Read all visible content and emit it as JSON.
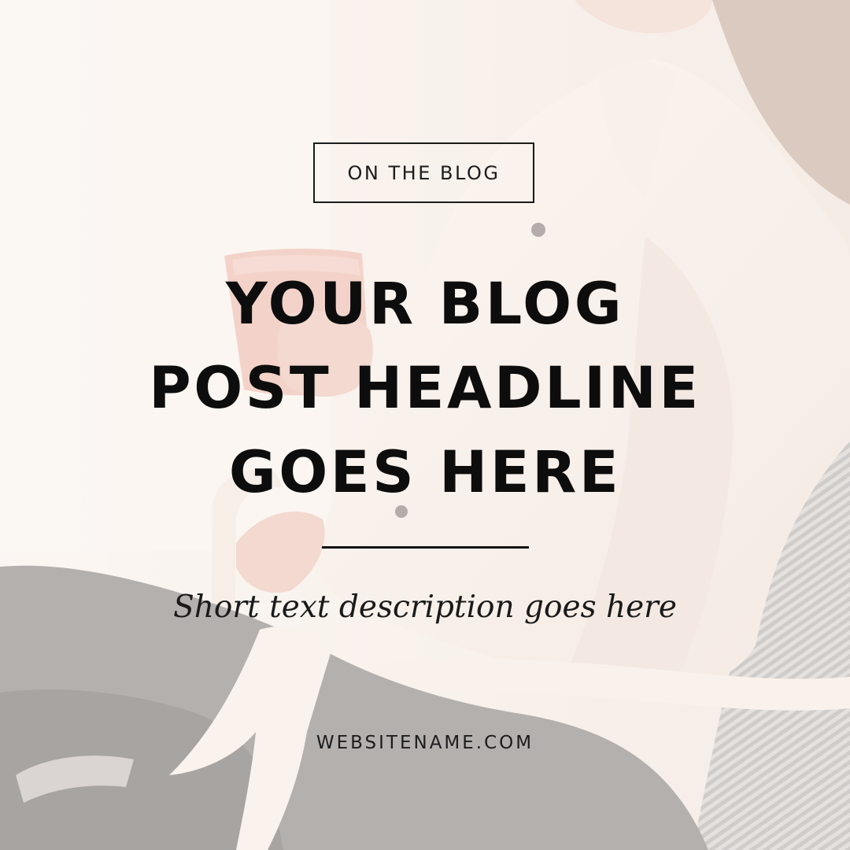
{
  "tag": {
    "label": "ON THE BLOG"
  },
  "headline": {
    "lines": [
      "YOUR BLOG",
      "POST HEADLINE",
      "GOES HERE"
    ]
  },
  "description": "Short text description goes here",
  "website": "WEBSITENAME.COM",
  "colors": {
    "text": "#111111",
    "background": "#f5ede7",
    "shirt": "#f8eee6",
    "jeans": "#8e8b8a",
    "mug": "#e9b8aa"
  },
  "image": {
    "subject-icon": "woman-holding-mug-photo"
  }
}
